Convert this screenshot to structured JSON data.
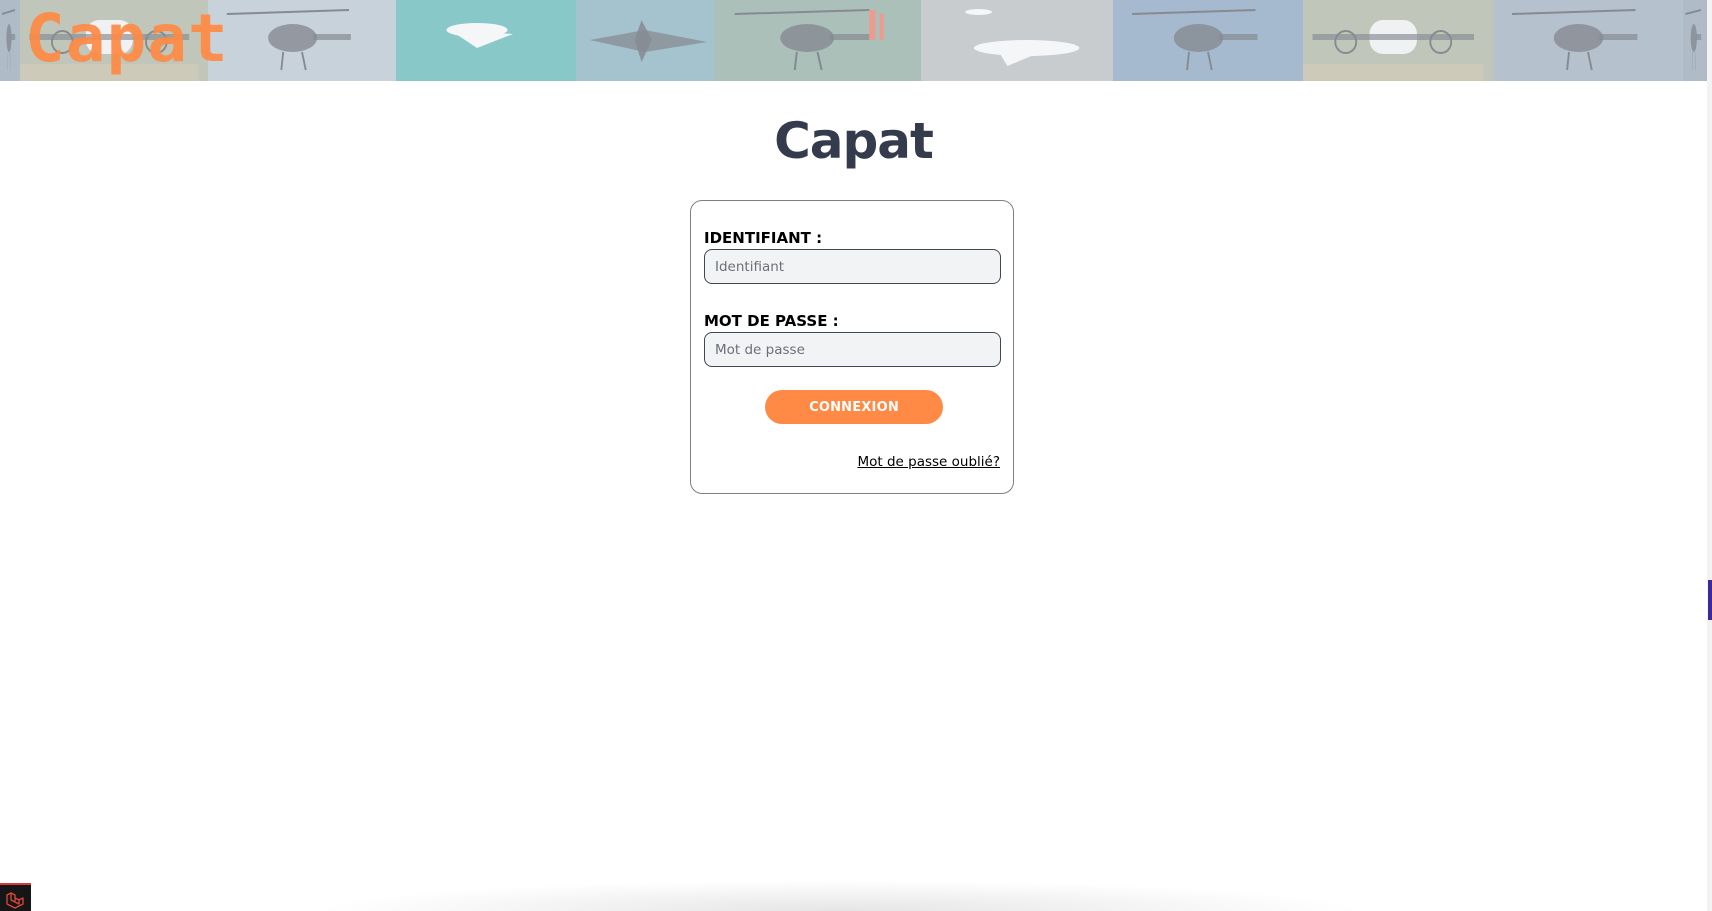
{
  "banner": {
    "logo_text": "Capat",
    "photos": [
      {
        "icon": "helicopter-photo-icon",
        "bg": "#7f93a6"
      },
      {
        "icon": "propeller-aircraft-photo-icon",
        "bg": "#9aa38f"
      },
      {
        "icon": "helicopter-photo-icon",
        "bg": "#a7b6c6"
      },
      {
        "icon": "jet-over-sea-photo-icon",
        "bg": "#3fa6a8"
      },
      {
        "icon": "fighter-jet-photo-icon",
        "bg": "#6f9fb0"
      },
      {
        "icon": "rescue-helicopter-photo-icon",
        "bg": "#7a9a90"
      },
      {
        "icon": "business-jet-photo-icon",
        "bg": "#a8adb2"
      },
      {
        "icon": "helicopter-photo-icon",
        "bg": "#6f90b0"
      },
      {
        "icon": "propeller-aircraft-photo-icon",
        "bg": "#9aa38f"
      },
      {
        "icon": "helicopter-photo-icon",
        "bg": "#8a9bb0"
      }
    ]
  },
  "page": {
    "title": "Capat"
  },
  "login": {
    "identifier_label": "IDENTIFIANT :",
    "identifier_placeholder": "Identifiant",
    "identifier_value": "",
    "password_label": "MOT DE PASSE :",
    "password_placeholder": "Mot de passe",
    "password_value": "",
    "submit_label": "CONNEXION",
    "forgot_label": "Mot de passe oublié?"
  },
  "colors": {
    "accent": "#ff8a45",
    "title": "#343b4d",
    "card_border": "#7b7f86",
    "input_bg": "#f2f3f5"
  },
  "debug": {
    "icon": "laravel-icon"
  }
}
